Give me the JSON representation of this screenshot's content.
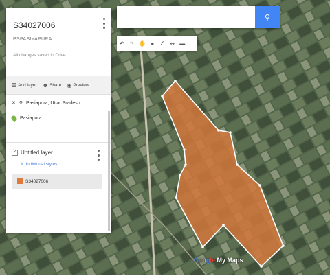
{
  "panel": {
    "map_title": "S34027006",
    "map_subtitle": "PSPASIYAPURA",
    "save_status": "All changes saved in Drive",
    "actions": [
      {
        "label": "Add layer",
        "icon": "layer-icon"
      },
      {
        "label": "Share",
        "icon": "share-icon"
      },
      {
        "label": "Preview",
        "icon": "preview-icon"
      }
    ],
    "search_result": {
      "query": "Pasiapura, Uttar Pradesh",
      "place": "Pasiapura"
    },
    "layer": {
      "name": "Untitled layer",
      "styles_link": "Individual styles",
      "feature": "S34027006"
    }
  },
  "search": {
    "value": "",
    "placeholder": ""
  },
  "toolbar": {
    "tools": [
      "undo-icon",
      "redo-icon",
      "hand-icon",
      "marker-icon",
      "draw-line-icon",
      "route-icon",
      "ruler-icon"
    ]
  },
  "branding": {
    "logo_text": "Google My Maps"
  },
  "colors": {
    "accent": "#4285f4",
    "polygon_fill": "#d2773c",
    "polygon_stroke": "#ffffff",
    "pin": "#7ab648"
  }
}
